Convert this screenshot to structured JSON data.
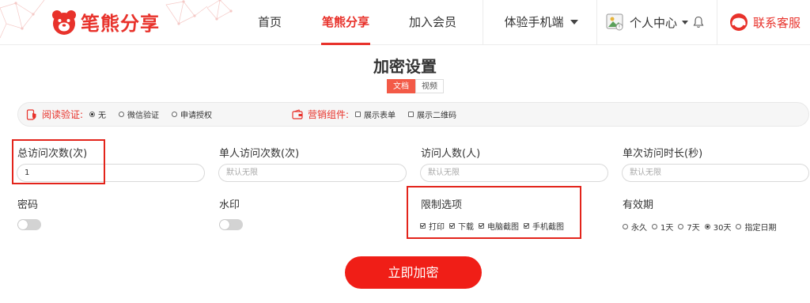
{
  "header": {
    "logo_text": "笔熊分享",
    "nav": [
      {
        "label": "首页"
      },
      {
        "label": "笔熊分享",
        "active": true
      },
      {
        "label": "加入会员"
      },
      {
        "label": "体验手机端"
      }
    ],
    "user_label": "个人中心",
    "service_label": "联系客服",
    "accent_color": "#e8322b"
  },
  "page_title": "加密设置",
  "tabs": [
    {
      "label": "文档",
      "active": true
    },
    {
      "label": "视频",
      "active": false
    }
  ],
  "verify": {
    "label": "阅读验证:",
    "options": [
      {
        "label": "无",
        "selected": true
      },
      {
        "label": "微信验证",
        "selected": false
      },
      {
        "label": "申请授权",
        "selected": false
      }
    ]
  },
  "marketing": {
    "label": "营销组件:",
    "options": [
      {
        "label": "展示表单",
        "checked": false
      },
      {
        "label": "展示二维码",
        "checked": false
      }
    ]
  },
  "fields": {
    "total_visits": {
      "label": "总访问次数(次)",
      "value": "1",
      "placeholder": ""
    },
    "single_visits": {
      "label": "单人访问次数(次)",
      "value": "",
      "placeholder": "默认无限"
    },
    "visitors": {
      "label": "访问人数(人)",
      "value": "",
      "placeholder": "默认无限"
    },
    "duration": {
      "label": "单次访问时长(秒)",
      "value": "",
      "placeholder": "默认无限"
    },
    "password": {
      "label": "密码",
      "enabled": false
    },
    "watermark": {
      "label": "水印",
      "enabled": false
    }
  },
  "restrictions": {
    "label": "限制选项",
    "options": [
      {
        "label": "打印",
        "checked": true
      },
      {
        "label": "下载",
        "checked": true
      },
      {
        "label": "电脑截图",
        "checked": true
      },
      {
        "label": "手机截图",
        "checked": true
      }
    ]
  },
  "validity": {
    "label": "有效期",
    "options": [
      {
        "label": "永久",
        "selected": false
      },
      {
        "label": "1天",
        "selected": false
      },
      {
        "label": "7天",
        "selected": false
      },
      {
        "label": "30天",
        "selected": true
      },
      {
        "label": "指定日期",
        "selected": false
      }
    ]
  },
  "submit_label": "立即加密",
  "icons": {
    "logo": "bear-logo-icon",
    "avatar": "user-avatar-icon",
    "bell": "bell-icon",
    "service": "headset-icon",
    "verify": "phone-shield-icon",
    "marketing": "wallet-icon"
  }
}
